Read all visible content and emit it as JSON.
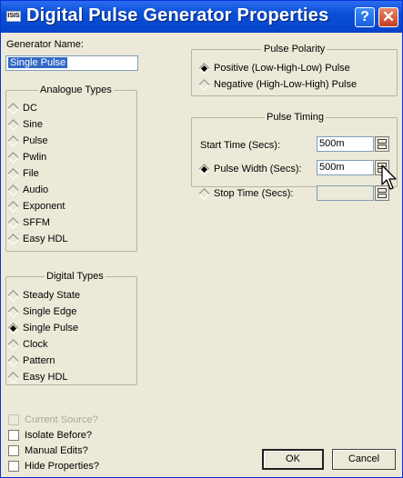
{
  "window": {
    "title": "Digital Pulse Generator Properties",
    "logo_text": "ISIS",
    "help_glyph": "?",
    "close_glyph": "✕"
  },
  "generator_name": {
    "label": "Generator Name:",
    "value": "Single Pulse"
  },
  "analogue_types": {
    "title": "Analogue Types",
    "items": [
      "DC",
      "Sine",
      "Pulse",
      "Pwlin",
      "File",
      "Audio",
      "Exponent",
      "SFFM",
      "Easy HDL"
    ]
  },
  "digital_types": {
    "title": "Digital Types",
    "items": [
      "Steady State",
      "Single Edge",
      "Single Pulse",
      "Clock",
      "Pattern",
      "Easy HDL"
    ],
    "selected": "Single Pulse"
  },
  "checkboxes": {
    "current_source": "Current Source?",
    "isolate_before": "Isolate Before?",
    "manual_edits": "Manual Edits?",
    "hide_properties": "Hide Properties?"
  },
  "pulse_polarity": {
    "title": "Pulse Polarity",
    "positive": "Positive (Low-High-Low) Pulse",
    "negative": "Negative (High-Low-High) Pulse",
    "selected": "positive"
  },
  "pulse_timing": {
    "title": "Pulse Timing",
    "start_time_label": "Start Time (Secs):",
    "start_time_value": "500m",
    "pulse_width_label": "Pulse Width (Secs):",
    "pulse_width_value": "500m",
    "stop_time_label": "Stop Time (Secs):",
    "stop_time_value": ""
  },
  "buttons": {
    "ok": "OK",
    "cancel": "Cancel"
  }
}
